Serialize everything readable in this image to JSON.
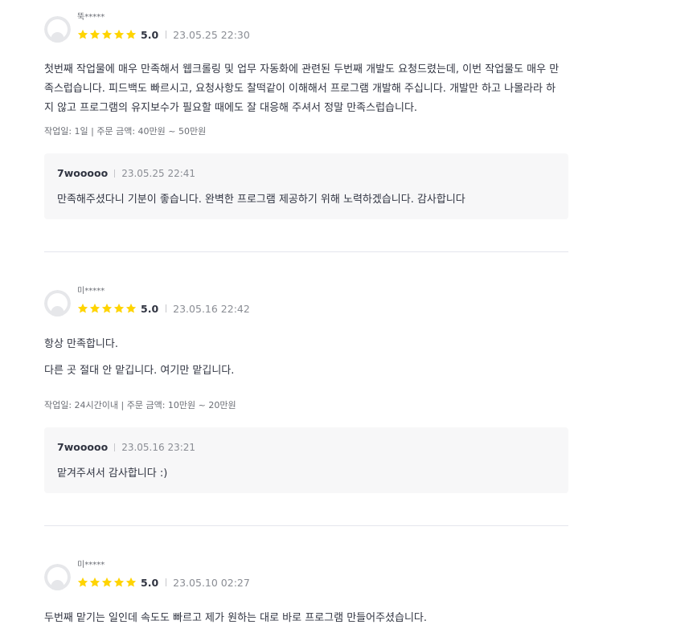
{
  "reviews": [
    {
      "user": "뚝*****",
      "score": "5.0",
      "date": "23.05.25 22:30",
      "content_lines": [
        "첫번째 작업물에 매우 만족해서 웹크롤링 및 업무 자동화에 관련된 두번째 개발도 요청드렸는데, 이번 작업물도 매우 만",
        "족스럽습니다. 피드백도 빠르시고, 요청사항도 찰떡같이 이해해서 프로그램 개발해 주십니다. 개발만 하고 나몰라라 하",
        "지 않고 프로그램의 유지보수가 필요할 때에도 잘 대응해 주셔서 정말 만족스럽습니다."
      ],
      "order_info": "작업일: 1일 | 주문 금액: 40만원 ~ 50만원",
      "reply": {
        "seller": "7wooooo",
        "date": "23.05.25 22:41",
        "text": "만족해주셨다니 기분이 좋습니다. 완벽한 프로그램 제공하기 위해 노력하겠습니다. 감사합니다"
      }
    },
    {
      "user": "미*****",
      "score": "5.0",
      "date": "23.05.16 22:42",
      "content_lines": [
        "항상 만족합니다.",
        "",
        "다른 곳 절대 안 맡깁니다. 여기만 맡깁니다."
      ],
      "order_info": "작업일: 24시간이내 | 주문 금액: 10만원 ~ 20만원",
      "reply": {
        "seller": "7wooooo",
        "date": "23.05.16 23:21",
        "text": "맡겨주셔서 감사합니다 :)"
      }
    },
    {
      "user": "미*****",
      "score": "5.0",
      "date": "23.05.10 02:27",
      "content_lines": [
        "두번째 맡기는 일인데 속도도 빠르고 제가 원하는 대로 바로 프로그램 만들어주셨습니다."
      ]
    }
  ],
  "rating": {
    "stars": 5,
    "star_color": "#ffd400"
  },
  "colors": {
    "text": "#303441",
    "muted": "#8a8d94",
    "reply_bg": "#f7f7f8",
    "divider": "#e4e5ed"
  },
  "icons": {
    "avatar": "default-user-avatar-icon",
    "star": "star-filled-icon"
  }
}
